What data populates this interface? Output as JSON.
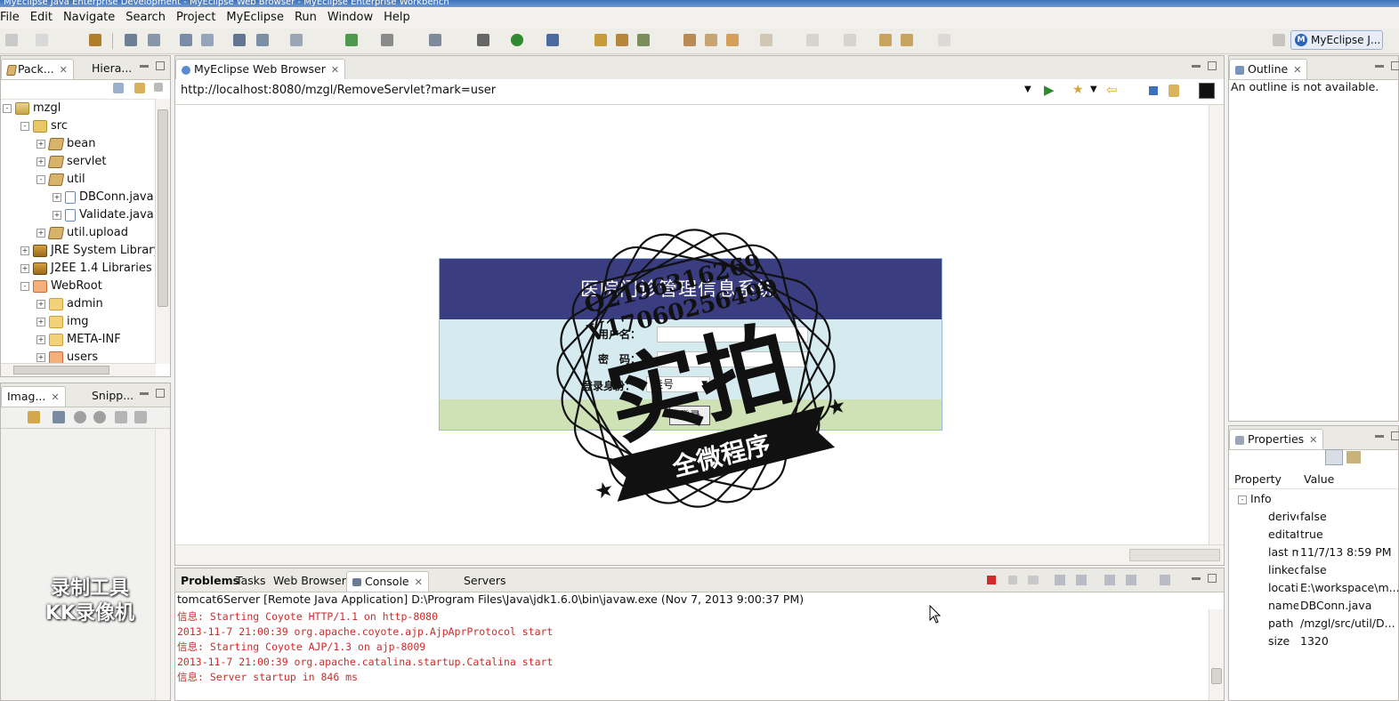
{
  "window": {
    "title": "MyEclipse Java Enterprise Development - MyEclipse Web Browser - MyEclipse Enterprise Workbench"
  },
  "menubar": {
    "items": [
      "File",
      "Edit",
      "Navigate",
      "Search",
      "Project",
      "MyEclipse",
      "Run",
      "Window",
      "Help"
    ]
  },
  "perspective": {
    "badge": "M",
    "label": "MyEclipse J..."
  },
  "package_view": {
    "tabs": [
      {
        "label": "Pack..."
      },
      {
        "label": "Hiera..."
      }
    ],
    "tree": [
      {
        "label": "mzgl",
        "level": 0,
        "icon": "project-icon",
        "expanded": "-"
      },
      {
        "label": "src",
        "level": 1,
        "icon": "source-folder-icon",
        "expanded": "-"
      },
      {
        "label": "bean",
        "level": 2,
        "icon": "package-icon",
        "expanded": "+"
      },
      {
        "label": "servlet",
        "level": 2,
        "icon": "package-icon",
        "expanded": "+"
      },
      {
        "label": "util",
        "level": 2,
        "icon": "package-icon",
        "expanded": "-"
      },
      {
        "label": "DBConn.java",
        "level": 3,
        "icon": "java-file-icon",
        "expanded": "+"
      },
      {
        "label": "Validate.java",
        "level": 3,
        "icon": "java-file-icon",
        "expanded": "+"
      },
      {
        "label": "util.upload",
        "level": 2,
        "icon": "package-icon",
        "expanded": "+"
      },
      {
        "label": "JRE System Library",
        "level": 1,
        "icon": "library-icon",
        "expanded": "+"
      },
      {
        "label": "J2EE 1.4 Libraries",
        "level": 1,
        "icon": "library-icon",
        "expanded": "+"
      },
      {
        "label": "WebRoot",
        "level": 1,
        "icon": "webroot-folder-icon",
        "expanded": "-"
      },
      {
        "label": "admin",
        "level": 2,
        "icon": "folder-icon",
        "expanded": "+"
      },
      {
        "label": "img",
        "level": 2,
        "icon": "folder-icon",
        "expanded": "+"
      },
      {
        "label": "META-INF",
        "level": 2,
        "icon": "folder-icon",
        "expanded": "+"
      },
      {
        "label": "users",
        "level": 2,
        "icon": "folder-icon",
        "expanded": "+"
      }
    ]
  },
  "image_view": {
    "tabs": [
      {
        "label": "Imag..."
      },
      {
        "label": "Snipp..."
      }
    ]
  },
  "browser": {
    "tab_label": "MyEclipse Web Browser",
    "url": "http://localhost:8080/mzgl/RemoveServlet?mark=user",
    "page": {
      "header_title": "医院门诊管理信息系统",
      "username_label": "用户名：",
      "password_label": "密　码：",
      "role_label": "登录身份：",
      "role_value": "挂号",
      "login_button": "登录"
    }
  },
  "watermark": {
    "line1": "Q2196316269",
    "line2": "V17060256499",
    "big": "实拍",
    "banner": "全微程序"
  },
  "outline_view": {
    "tab_label": "Outline",
    "message": "An outline is not available."
  },
  "properties_view": {
    "tab_label": "Properties",
    "col_property": "Property",
    "col_value": "Value",
    "group": "Info",
    "rows": [
      {
        "key": "derive",
        "value": "false"
      },
      {
        "key": "editat",
        "value": "true"
      },
      {
        "key": "last m",
        "value": "11/7/13 8:59 PM"
      },
      {
        "key": "linked",
        "value": "false"
      },
      {
        "key": "locatic",
        "value": "E:\\workspace\\m..."
      },
      {
        "key": "name",
        "value": "DBConn.java"
      },
      {
        "key": "path",
        "value": "/mzgl/src/util/D..."
      },
      {
        "key": "size",
        "value": "1320"
      }
    ]
  },
  "console_view": {
    "tabs": [
      {
        "label": "Problems",
        "bold": true
      },
      {
        "label": "Tasks"
      },
      {
        "label": "Web Browser"
      },
      {
        "label": "Console",
        "active": true
      },
      {
        "label": "Servers"
      }
    ],
    "process_header": "tomcat6Server [Remote Java Application] D:\\Program Files\\Java\\jdk1.6.0\\bin\\javaw.exe (Nov 7, 2013 9:00:37 PM)",
    "lines": [
      "信息: Starting Coyote HTTP/1.1 on http-8080",
      "2013-11-7 21:00:39 org.apache.coyote.ajp.AjpAprProtocol start",
      "信息: Starting Coyote AJP/1.3 on ajp-8009",
      "2013-11-7 21:00:39 org.apache.catalina.startup.Catalina start",
      "信息: Server startup in 846 ms"
    ]
  },
  "recorder_logo": {
    "line1": "录制工具",
    "line2": "KK录像机"
  },
  "colors": {
    "login_header": "#3a3d80",
    "login_body": "#d5ebef",
    "login_footer": "#cfe2b5",
    "console_text": "#d12a2a",
    "watermark": "#111111"
  }
}
